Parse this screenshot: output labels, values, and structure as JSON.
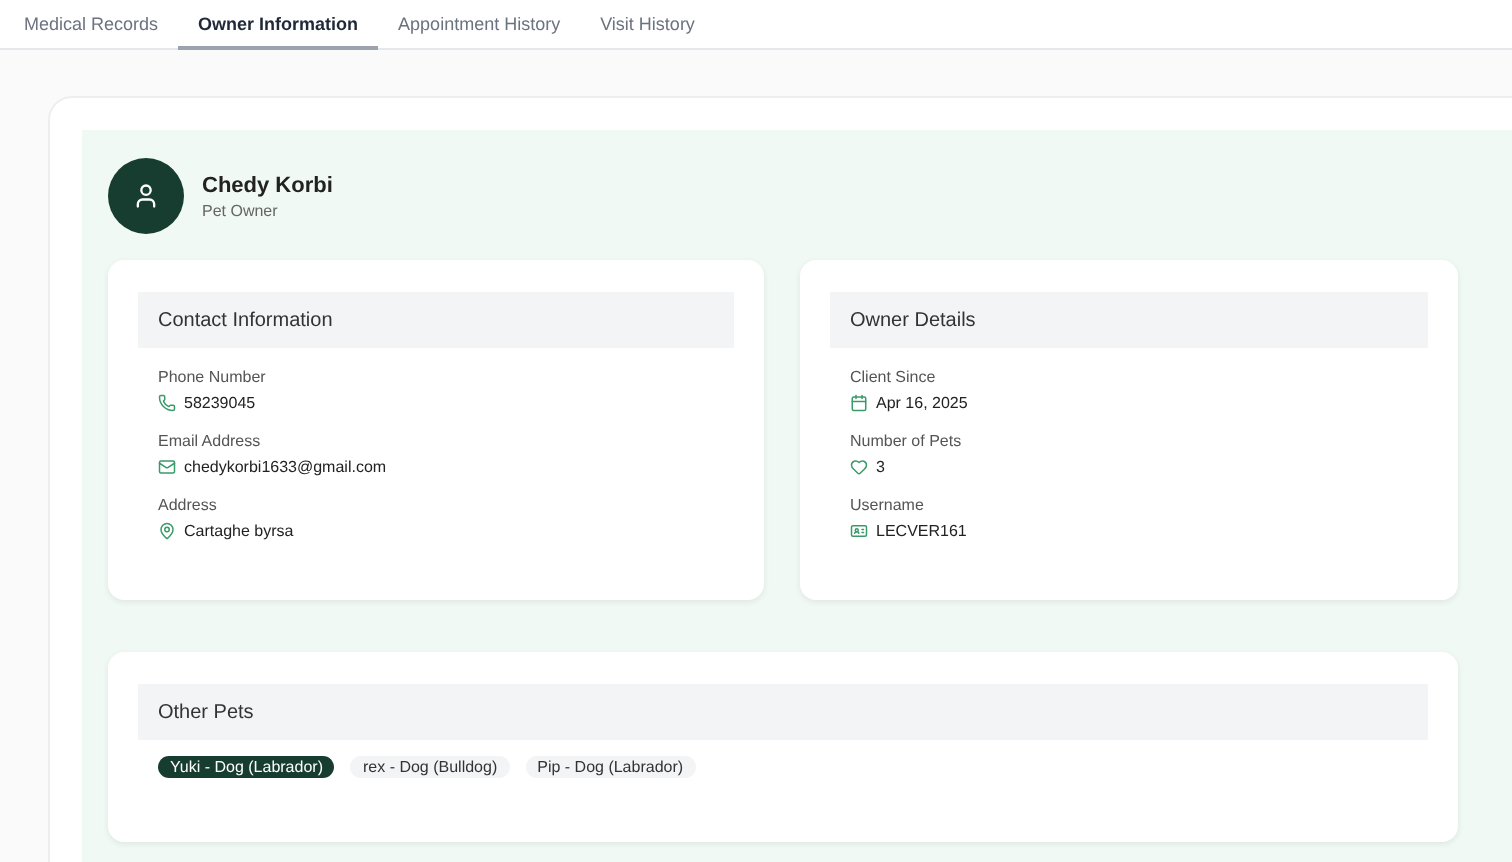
{
  "tabs": [
    {
      "label": "Medical Records",
      "selected": false
    },
    {
      "label": "Owner Information",
      "selected": true
    },
    {
      "label": "Appointment History",
      "selected": false
    },
    {
      "label": "Visit History",
      "selected": false
    }
  ],
  "owner": {
    "name": "Chedy Korbi",
    "role": "Pet Owner"
  },
  "sections": [
    {
      "title": "Contact Information",
      "fields": [
        {
          "label": "Phone Number",
          "value": "58239045",
          "kind": "phone"
        },
        {
          "label": "Email Address",
          "value": "chedykorbi1633@gmail.com",
          "kind": "email"
        },
        {
          "label": "Address",
          "value": "Cartaghe byrsa",
          "kind": "address"
        }
      ]
    },
    {
      "title": "Owner Details",
      "fields": [
        {
          "label": "Client Since",
          "value": "Apr 16, 2025",
          "kind": "date"
        },
        {
          "label": "Number of Pets",
          "value": "3",
          "kind": "pets"
        },
        {
          "label": "Username",
          "value": "LECVER161",
          "kind": "username"
        }
      ]
    }
  ],
  "other_pets": {
    "title": "Other Pets",
    "pets": [
      {
        "label": "Yuki - Dog (Labrador)",
        "selected": true
      },
      {
        "label": "rex - Dog (Bulldog)",
        "selected": false
      },
      {
        "label": "Pip - Dog (Labrador)",
        "selected": false
      }
    ]
  }
}
